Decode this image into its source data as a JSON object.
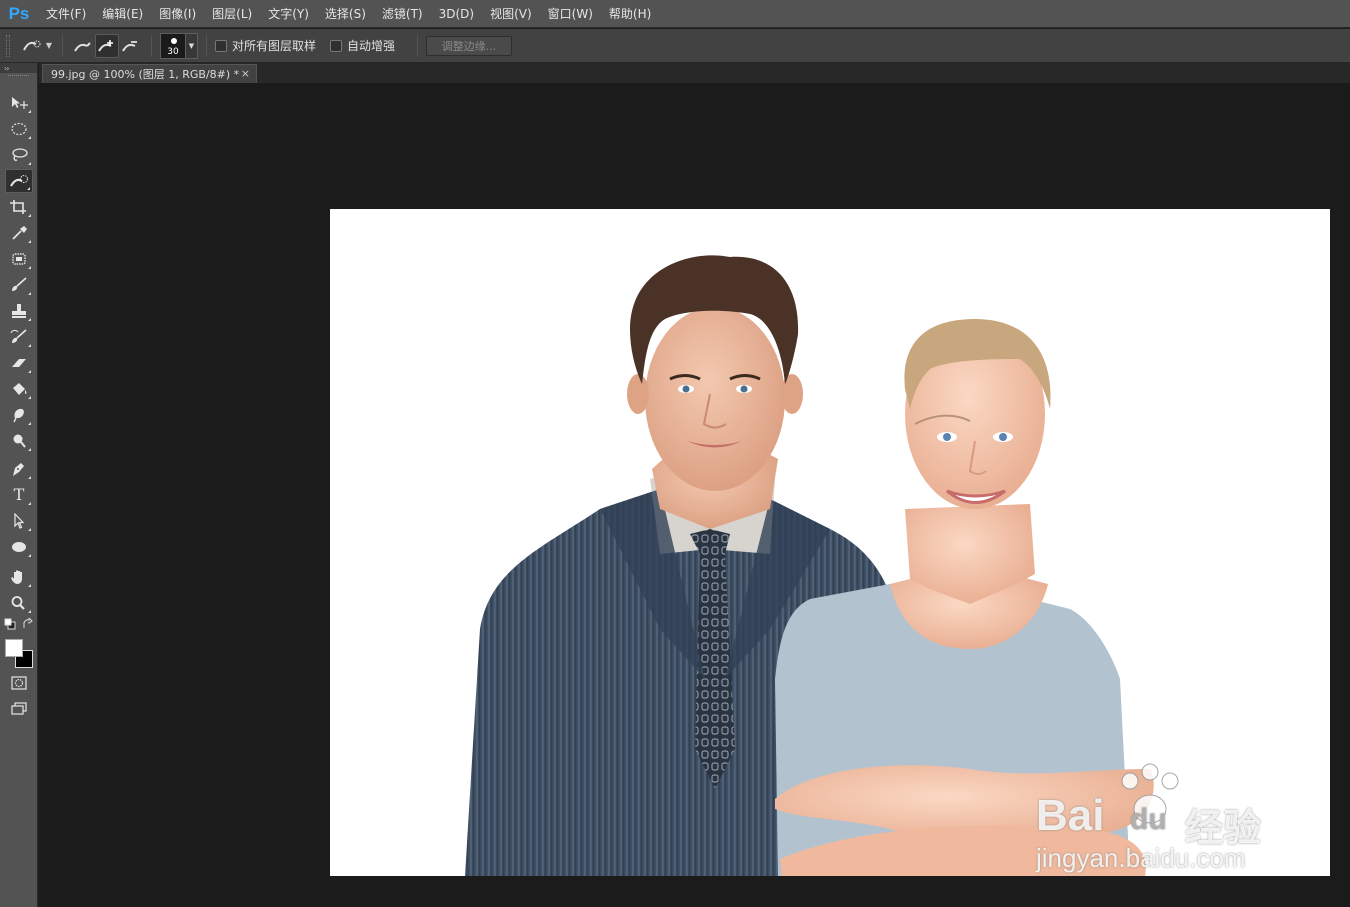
{
  "app": {
    "logo": "Ps"
  },
  "menu": [
    {
      "label": "文件(F)"
    },
    {
      "label": "编辑(E)"
    },
    {
      "label": "图像(I)"
    },
    {
      "label": "图层(L)"
    },
    {
      "label": "文字(Y)"
    },
    {
      "label": "选择(S)"
    },
    {
      "label": "滤镜(T)"
    },
    {
      "label": "3D(D)"
    },
    {
      "label": "视图(V)"
    },
    {
      "label": "窗口(W)"
    },
    {
      "label": "帮助(H)"
    }
  ],
  "options_bar": {
    "tool_icon": "quick-selection-icon",
    "modes": [
      "new-selection-icon",
      "add-to-selection-icon",
      "subtract-from-selection-icon"
    ],
    "brush_size": "30",
    "sample_all_layers_label": "对所有图层取样",
    "sample_all_layers_checked": false,
    "auto_enhance_label": "自动增强",
    "auto_enhance_checked": false,
    "refine_edge_label": "调整边缘..."
  },
  "document": {
    "tab_title": "99.jpg @ 100% (图层 1, RGB/8#) *",
    "close_glyph": "×"
  },
  "toolbox": {
    "collapse_glyph": "››",
    "tools": [
      "move-icon",
      "elliptical-marquee-icon",
      "lasso-icon",
      "quick-selection-icon",
      "crop-icon",
      "eyedropper-icon",
      "spot-healing-icon",
      "brush-icon",
      "clone-stamp-icon",
      "history-brush-icon",
      "eraser-icon",
      "paint-bucket-icon",
      "blur-icon",
      "dodge-icon",
      "pen-icon",
      "type-icon",
      "path-selection-icon",
      "ellipse-shape-icon",
      "hand-icon",
      "zoom-icon"
    ],
    "type_glyph": "T",
    "foreground_color": "#ffffff",
    "background_color": "#000000"
  },
  "watermark": {
    "brand": "Bai",
    "brand_suffix": "du",
    "product": "经验",
    "url": "jingyan.baidu.com"
  },
  "colors": {
    "accent": "#31a8ff",
    "canvas_bg": "#ffffff",
    "workspace_bg": "#1b1b1b"
  }
}
